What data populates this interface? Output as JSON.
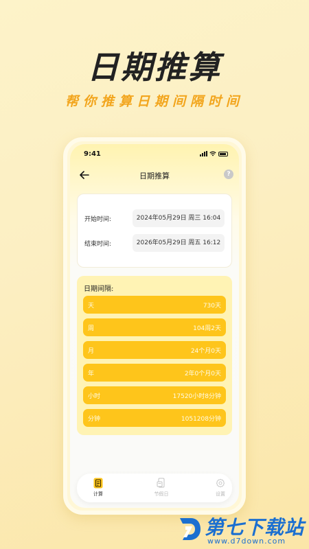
{
  "hero": {
    "title": "日期推算",
    "subtitle": "帮你推算日期间隔时间"
  },
  "status_bar": {
    "time": "9:41"
  },
  "nav": {
    "title": "日期推算",
    "back_icon": "arrow-left-icon",
    "help_icon": "question-circle-icon",
    "help_glyph": "?"
  },
  "time_card": {
    "start": {
      "label": "开始时间:",
      "value": "2024年05月29日 周三 16:04"
    },
    "end": {
      "label": "结束时间:",
      "value": "2026年05月29日 周五 16:12"
    }
  },
  "result": {
    "title": "日期间隔:",
    "items": [
      {
        "label": "天",
        "value": "730天"
      },
      {
        "label": "周",
        "value": "104周2天"
      },
      {
        "label": "月",
        "value": "24个月0天"
      },
      {
        "label": "年",
        "value": "2年0个月0天"
      },
      {
        "label": "小时",
        "value": "17520小时8分钟"
      },
      {
        "label": "分钟",
        "value": "1051208分钟"
      }
    ]
  },
  "tabbar": {
    "items": [
      {
        "label": "计算",
        "icon": "calculator-icon",
        "active": true
      },
      {
        "label": "节假日",
        "icon": "calendar-phone-icon",
        "active": false
      },
      {
        "label": "设置",
        "icon": "gear-icon",
        "active": false
      }
    ]
  },
  "watermark": {
    "name": "第七下载站",
    "url": "www.d7down.com"
  },
  "colors": {
    "accent": "#fec51b",
    "subtitle": "#f2a51d",
    "watermark": "#1b6fd0"
  }
}
